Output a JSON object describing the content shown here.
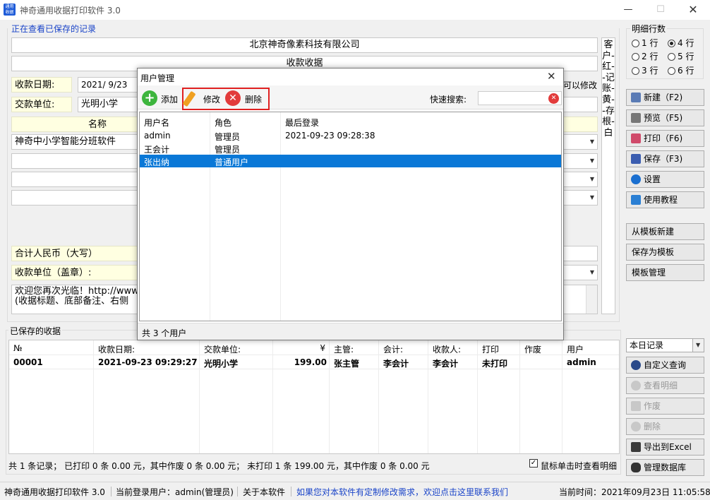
{
  "window": {
    "title": "神奇通用收据打印软件 3.0",
    "icon_text": "通用收据"
  },
  "viewing_notice": "正在查看已保存的记录",
  "receipt": {
    "company": "北京神奇像素科技有限公司",
    "title": "收款收据",
    "date_label": "收款日期:",
    "date_value": "2021/  9/23",
    "payer_label": "交款单位:",
    "payer_value": "光明小学",
    "editable_hint": "可以修改",
    "col_name": "名称",
    "rows": [
      "神奇中小学智能分班软件",
      "",
      "",
      ""
    ],
    "total_label": "合计人民币（大写）",
    "payee_label": "收款单位（盖章）:",
    "footnote_line1": "欢迎您再次光临！http://www",
    "footnote_line2": "(收据标题、底部备注、右侧"
  },
  "copy_column": "客户-红--记账-黄--存根-白",
  "detail_rows": {
    "group_label": "明细行数",
    "options": [
      "1 行",
      "4 行",
      "2 行",
      "5 行",
      "3 行",
      "6 行"
    ],
    "selected": "4 行"
  },
  "side_buttons": [
    {
      "label": "新建（F2)",
      "icon": "new-doc-icon",
      "color": "#5a7bb5"
    },
    {
      "label": "预览（F5)",
      "icon": "printer-preview-icon",
      "color": "#777777"
    },
    {
      "label": "打印（F6)",
      "icon": "printer-icon",
      "color": "#d04a6a"
    },
    {
      "label": "保存（F3)",
      "icon": "save-icon",
      "color": "#3b5db0"
    },
    {
      "label": "设置",
      "icon": "gear-icon",
      "color": "#1a6fd0"
    },
    {
      "label": "使用教程",
      "icon": "book-icon",
      "color": "#2a7fd4"
    }
  ],
  "template_buttons": [
    "从模板新建",
    "保存为模板",
    "模板管理"
  ],
  "saved_section": {
    "label": "已保存的收据",
    "filter_value": "本日记录",
    "columns": [
      "№",
      "收款日期:",
      "交款单位:",
      "¥",
      "主管:",
      "会计:",
      "收款人:",
      "打印",
      "作废",
      "用户"
    ],
    "rows": [
      [
        "00001",
        "2021-09-23 09:29:27",
        "光明小学",
        "199.00",
        "张主管",
        "李会计",
        "李会计",
        "未打印",
        "",
        "admin"
      ]
    ],
    "summary": "共 1 条记录；   已打印 0 条 0.00 元，其中作废 0 条 0.00 元；   未打印 1 条 199.00 元，其中作废 0 条 0.00 元",
    "checkbox_label": "鼠标单击时查看明细",
    "checkbox_checked": true
  },
  "saved_buttons": [
    {
      "label": "自定义查询",
      "icon": "magnifier-icon",
      "disabled": false
    },
    {
      "label": "查看明细",
      "icon": "view-detail-icon",
      "disabled": true
    },
    {
      "label": "作废",
      "icon": "void-icon",
      "disabled": true
    },
    {
      "label": "删除",
      "icon": "delete-icon",
      "disabled": true
    },
    {
      "label": "导出到Excel",
      "icon": "export-icon",
      "disabled": false
    },
    {
      "label": "管理数据库",
      "icon": "database-icon",
      "disabled": false
    }
  ],
  "dialog": {
    "title": "用户管理",
    "add_label": "添加",
    "edit_label": "修改",
    "delete_label": "删除",
    "search_label": "快速搜索:",
    "search_value": "",
    "columns": [
      "用户名",
      "角色",
      "最后登录"
    ],
    "rows": [
      [
        "admin",
        "管理员",
        "2021-09-23 09:28:38"
      ],
      [
        "王会计",
        "管理员",
        ""
      ],
      [
        "张出纳",
        "普通用户",
        ""
      ]
    ],
    "selected_row": 2,
    "footer": "共 3 个用户"
  },
  "statusbar": {
    "app": "神奇通用收据打印软件 3.0",
    "login": "当前登录用户：admin(管理员)",
    "about": "关于本软件",
    "link": "如果您对本软件有定制修改需求，欢迎点击这里联系我们",
    "time": "当前时间：2021年09月23日 11:05:58"
  }
}
